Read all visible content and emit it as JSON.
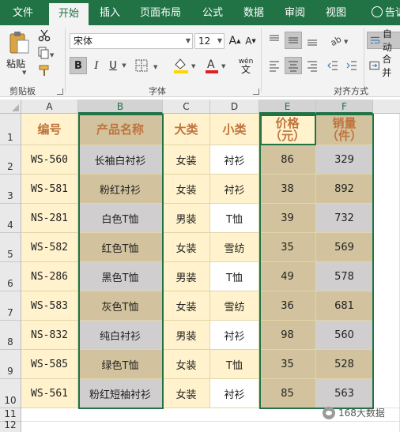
{
  "tabs": [
    "文件",
    "开始",
    "插入",
    "页面布局",
    "公式",
    "数据",
    "审阅",
    "视图"
  ],
  "tell_me": "告诉",
  "ribbon": {
    "clipboard": {
      "paste_label": "粘贴",
      "group_label": "剪贴板"
    },
    "font": {
      "font_name": "宋体",
      "font_size": "12",
      "bold": "B",
      "italic": "I",
      "underline": "U",
      "phonetic": "wén",
      "group_label": "字体"
    },
    "alignment": {
      "wrap_label": "自动",
      "merge_label": "合并",
      "group_label": "对齐方式"
    }
  },
  "columns": [
    "A",
    "B",
    "C",
    "D",
    "E",
    "F"
  ],
  "rows": [
    "1",
    "2",
    "3",
    "4",
    "5",
    "6",
    "7",
    "8",
    "9",
    "10",
    "11",
    "12"
  ],
  "table": {
    "headers": [
      "编号",
      "产品名称",
      "大类",
      "小类",
      "价格\n（元）",
      "销量\n（件）"
    ],
    "data": [
      [
        "WS-560",
        "长袖白衬衫",
        "女装",
        "衬衫",
        "86",
        "329"
      ],
      [
        "WS-581",
        "粉红衬衫",
        "女装",
        "衬衫",
        "38",
        "892"
      ],
      [
        "NS-281",
        "白色T恤",
        "男装",
        "T恤",
        "39",
        "732"
      ],
      [
        "WS-582",
        "红色T恤",
        "女装",
        "雪纺",
        "35",
        "569"
      ],
      [
        "NS-286",
        "黑色T恤",
        "男装",
        "T恤",
        "49",
        "578"
      ],
      [
        "WS-583",
        "灰色T恤",
        "女装",
        "雪纺",
        "36",
        "681"
      ],
      [
        "NS-832",
        "纯白衬衫",
        "男装",
        "衬衫",
        "98",
        "560"
      ],
      [
        "WS-585",
        "绿色T恤",
        "女装",
        "T恤",
        "35",
        "528"
      ],
      [
        "WS-561",
        "粉红短袖衬衫",
        "女装",
        "衬衫",
        "85",
        "563"
      ]
    ]
  },
  "watermark": "168大数据",
  "colors": {
    "excel_green": "#217346",
    "header_text": "#c0733d",
    "cream": "#fff2cc",
    "gray": "#d0cece",
    "tan": "#d2c39e",
    "font_color": "#e02020",
    "highlight": "#ffd700"
  }
}
